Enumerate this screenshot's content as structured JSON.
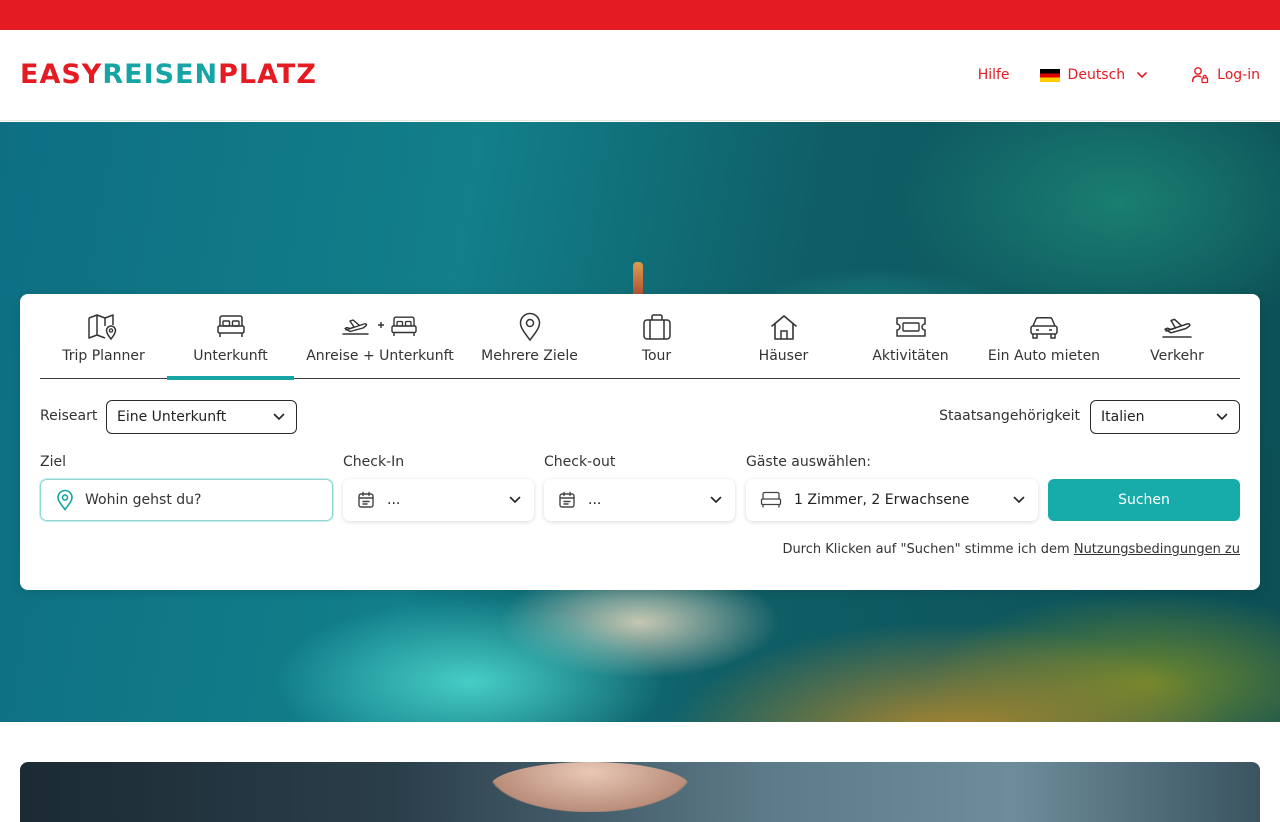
{
  "header": {
    "logo": {
      "part1": "EASY",
      "part2": "REISEN",
      "part3": "PLATZ"
    },
    "help": "Hilfe",
    "language": "Deutsch",
    "login": "Log-in"
  },
  "tabs": [
    {
      "label": "Trip Planner",
      "icon": "map-pin-icon",
      "active": false
    },
    {
      "label": "Unterkunft",
      "icon": "bed-icon",
      "active": true
    },
    {
      "label": "Anreise + Unterkunft",
      "icon": "plane-plus-bed-icon",
      "active": false
    },
    {
      "label": "Mehrere Ziele",
      "icon": "location-pin-icon",
      "active": false
    },
    {
      "label": "Tour",
      "icon": "suitcase-icon",
      "active": false
    },
    {
      "label": "Häuser",
      "icon": "house-icon",
      "active": false
    },
    {
      "label": "Aktivitäten",
      "icon": "ticket-icon",
      "active": false
    },
    {
      "label": "Ein Auto mieten",
      "icon": "car-icon",
      "active": false
    },
    {
      "label": "Verkehr",
      "icon": "plane-icon",
      "active": false
    }
  ],
  "form": {
    "reiseart_label": "Reiseart",
    "reiseart_value": "Eine Unterkunft",
    "staat_label": "Staatsangehörigkeit",
    "staat_value": "Italien",
    "ziel_label": "Ziel",
    "ziel_placeholder": "Wohin gehst du?",
    "checkin_label": "Check-In",
    "checkin_value": "...",
    "checkout_label": "Check-out",
    "checkout_value": "...",
    "guests_label": "Gäste auswählen:",
    "guests_value": "1 Zimmer, 2 Erwachsene",
    "search_button": "Suchen",
    "terms_text": "Durch Klicken auf \"Suchen\" stimme ich dem ",
    "terms_link": "Nutzungsbedingungen zu"
  },
  "colors": {
    "brand_red": "#e41b23",
    "brand_teal": "#17a4a4",
    "button_teal": "#17acaa"
  }
}
